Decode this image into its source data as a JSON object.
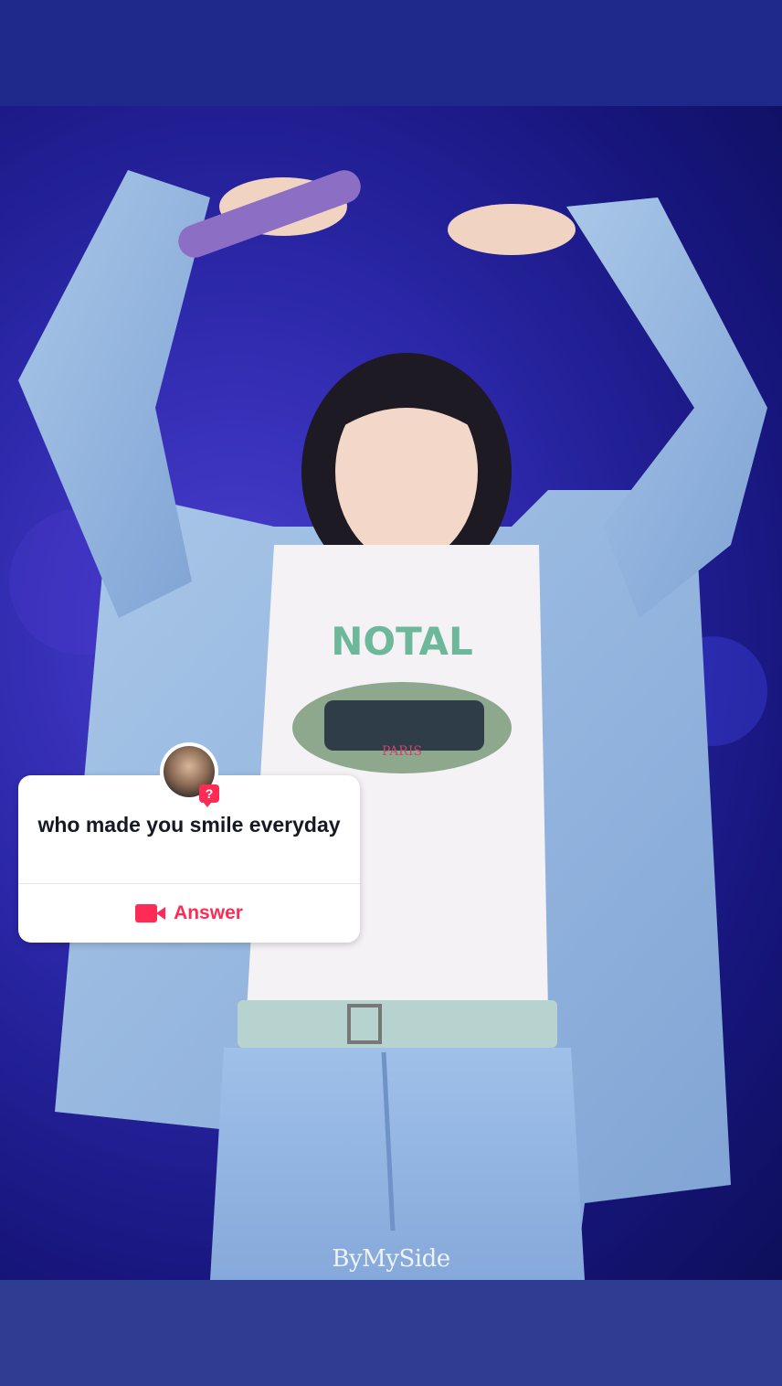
{
  "story": {
    "watermark": "ByMySide"
  },
  "question_sticker": {
    "question": "who made you smile everyday",
    "answer_label": "Answer",
    "answer_icon": "video-camera-icon",
    "badge_icon": "question-mark-icon",
    "badge_text": "?",
    "accent_color": "#fe2c55"
  },
  "colors": {
    "top_band": "#1d2a8c",
    "bottom_band": "#2e3d92"
  }
}
